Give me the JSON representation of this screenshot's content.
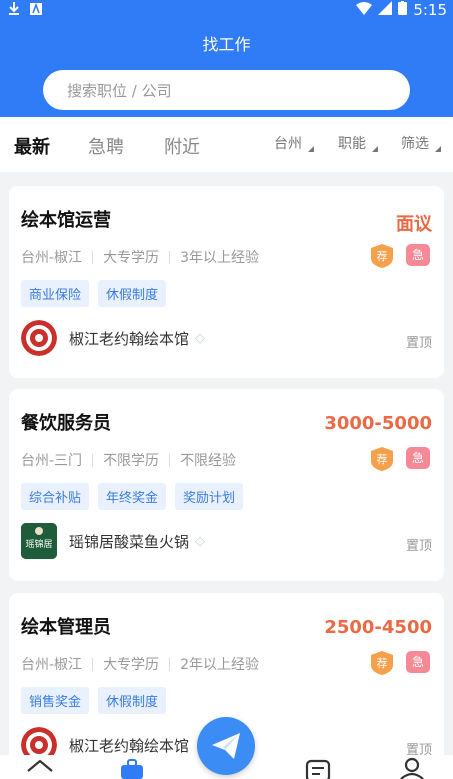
{
  "status_bar": {
    "time": "5:15"
  },
  "header": {
    "title": "找工作"
  },
  "search": {
    "placeholder": "搜索职位 / 公司"
  },
  "tabs": [
    {
      "label": "最新",
      "active": true
    },
    {
      "label": "急聘",
      "active": false
    },
    {
      "label": "附近",
      "active": false
    }
  ],
  "filters": [
    {
      "label": "台州"
    },
    {
      "label": "职能"
    },
    {
      "label": "筛选"
    }
  ],
  "jobs": [
    {
      "title": "绘本馆运营",
      "salary": "面议",
      "location": "台州-椒江",
      "education": "大专学历",
      "experience": "3年以上经验",
      "badge_recommend": "荐",
      "badge_urgent": "急",
      "tags": [
        "商业保险",
        "休假制度"
      ],
      "company": "椒江老约翰绘本馆",
      "pin": "置顶"
    },
    {
      "title": "餐饮服务员",
      "salary": "3000-5000",
      "location": "台州-三门",
      "education": "不限学历",
      "experience": "不限经验",
      "badge_recommend": "荐",
      "badge_urgent": "急",
      "tags": [
        "综合补贴",
        "年终奖金",
        "奖励计划"
      ],
      "company": "瑶锦居酸菜鱼火锅",
      "logo_text": "瑶锦居",
      "pin": "置顶"
    },
    {
      "title": "绘本管理员",
      "salary": "2500-4500",
      "location": "台州-椒江",
      "education": "大专学历",
      "experience": "2年以上经验",
      "badge_recommend": "荐",
      "badge_urgent": "急",
      "tags": [
        "销售奖金",
        "休假制度"
      ],
      "company": "椒江老约翰绘本馆",
      "pin": "置顶"
    }
  ],
  "colors": {
    "primary": "#2f7cf6",
    "salary": "#ea6a45",
    "tag_bg": "#e8f1fd",
    "tag_text": "#3a7be0",
    "urgent": "#f58a96",
    "recommend": "#f5a04a"
  },
  "bottom_nav": [
    {
      "icon": "home-icon"
    },
    {
      "icon": "briefcase-icon",
      "active": true
    },
    {
      "icon": "send-icon"
    },
    {
      "icon": "resume-icon"
    },
    {
      "icon": "profile-icon"
    }
  ]
}
